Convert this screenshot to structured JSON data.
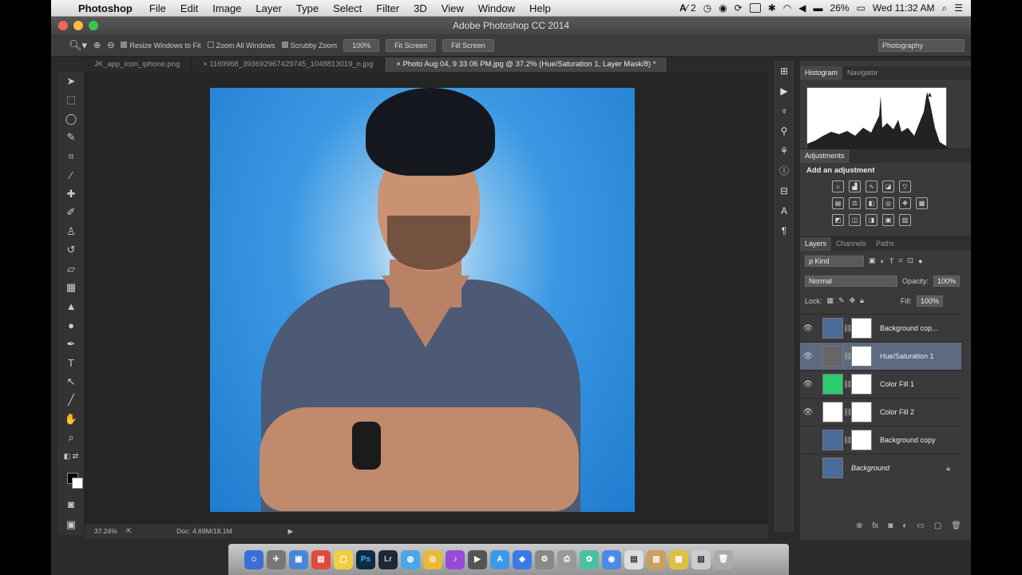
{
  "menubar": {
    "app": "Photoshop",
    "items": [
      "File",
      "Edit",
      "Image",
      "Layer",
      "Type",
      "Select",
      "Filter",
      "3D",
      "View",
      "Window",
      "Help"
    ],
    "battery": "26%",
    "clock": "Wed 11:32 AM",
    "status_ai": "2"
  },
  "window": {
    "title": "Adobe Photoshop CC 2014"
  },
  "options": {
    "resize_windows": "Resize Windows to Fit",
    "zoom_all": "Zoom All Windows",
    "scrubby_zoom": "Scrubby Zoom",
    "btn_100": "100%",
    "btn_fit": "Fit Screen",
    "btn_fill": "Fill Screen",
    "workspace": "Photography"
  },
  "tabs": [
    "JK_app_icon_iphone.png",
    "1169968_393692967429745_1048813019_n.jpg",
    "Photo Aug 04, 9 33 06 PM.jpg @ 37.2% (Hue/Saturation 1, Layer Mask/8) *"
  ],
  "status": {
    "zoom": "37.24%",
    "doc": "Doc: 4.69M/18.1M"
  },
  "panels": {
    "histogram_tab": "Histogram",
    "navigator_tab": "Navigator",
    "adjustments_tab": "Adjustments",
    "add_adjustment": "Add an adjustment",
    "layers_tab": "Layers",
    "channels_tab": "Channels",
    "paths_tab": "Paths",
    "kind": "ρ Kind",
    "blend_mode": "Normal",
    "opacity_label": "Opacity:",
    "opacity": "100%",
    "lock_label": "Lock:",
    "fill_label": "Fill:",
    "fill": "100%"
  },
  "layers": [
    {
      "name": "Background cop...",
      "visible": true,
      "thumb": "#4a6b9a",
      "mask": true
    },
    {
      "name": "Hue/Saturation 1",
      "visible": true,
      "thumb": "#666666",
      "mask": true
    },
    {
      "name": "Color Fill 1",
      "visible": true,
      "thumb": "#2ecc71",
      "mask": true
    },
    {
      "name": "Color Fill 2",
      "visible": true,
      "thumb": "#ffffff",
      "mask": true
    },
    {
      "name": "Background copy",
      "visible": false,
      "thumb": "#4a6b9a",
      "mask": true
    },
    {
      "name": "Background",
      "visible": false,
      "thumb": "#4a6b9a",
      "mask": false
    }
  ],
  "colors": {
    "accent_selected": "#5d6a80",
    "canvas_blue": "#1f7ccf"
  }
}
